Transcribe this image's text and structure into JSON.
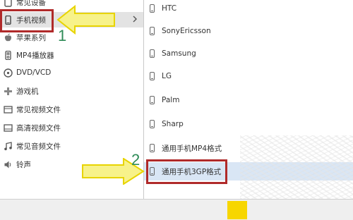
{
  "categories": [
    {
      "label": "常见设备",
      "icon": "device-icon"
    },
    {
      "label": "手机视频",
      "icon": "phone-icon"
    },
    {
      "label": "苹果系列",
      "icon": "apple-icon"
    },
    {
      "label": "MP4播放器",
      "icon": "mp4-player-icon"
    },
    {
      "label": "DVD/VCD",
      "icon": "disc-icon"
    },
    {
      "label": "游戏机",
      "icon": "gamepad-icon"
    },
    {
      "label": "常见视频文件",
      "icon": "video-file-icon"
    },
    {
      "label": "高清视频文件",
      "icon": "hd-video-icon"
    },
    {
      "label": "常见音频文件",
      "icon": "music-note-icon"
    },
    {
      "label": "铃声",
      "icon": "speaker-icon"
    }
  ],
  "selected_category": "手机视频",
  "devices": [
    {
      "label": "HTC"
    },
    {
      "label": "SonyEricsson"
    },
    {
      "label": "Samsung"
    },
    {
      "label": "LG"
    },
    {
      "label": "Palm"
    },
    {
      "label": "Sharp"
    },
    {
      "label": "通用手机MP4格式"
    },
    {
      "label": "通用手机3GP格式"
    }
  ],
  "selected_device": "通用手机3GP格式",
  "annotations": {
    "step1": "1",
    "step2": "2"
  },
  "colors": {
    "highlight_box": "#b02a2a",
    "arrow_fill": "#f7f28a",
    "arrow_stroke": "#e8d400",
    "step_number": "#2e8b57",
    "selected_row": "#d9e6f5"
  }
}
